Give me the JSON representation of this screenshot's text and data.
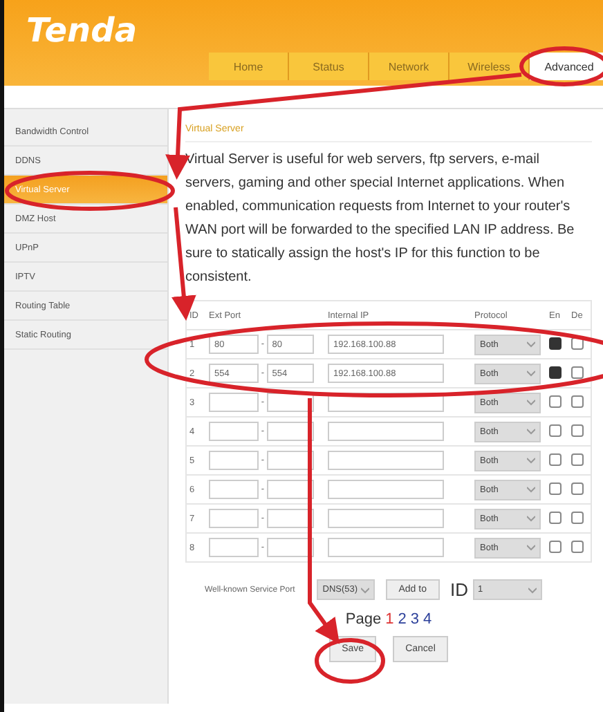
{
  "header": {
    "logo": "Tenda",
    "tabs": [
      {
        "label": "Home",
        "selected": false
      },
      {
        "label": "Status",
        "selected": false
      },
      {
        "label": "Network",
        "selected": false
      },
      {
        "label": "Wireless",
        "selected": false
      },
      {
        "label": "Advanced",
        "selected": true
      }
    ]
  },
  "sidebar": {
    "items": [
      {
        "label": "Bandwidth Control",
        "selected": false
      },
      {
        "label": "DDNS",
        "selected": false
      },
      {
        "label": "Virtual Server",
        "selected": true
      },
      {
        "label": "DMZ Host",
        "selected": false
      },
      {
        "label": "UPnP",
        "selected": false
      },
      {
        "label": "IPTV",
        "selected": false
      },
      {
        "label": "Routing Table",
        "selected": false
      },
      {
        "label": "Static Routing",
        "selected": false
      }
    ]
  },
  "content": {
    "title": "Virtual Server",
    "description": "Virtual Server is useful for web servers, ftp servers, e-mail servers, gaming and other special Internet applications. When enabled, communication requests from Internet to your router's WAN port will be forwarded to the specified LAN IP address. Be sure to statically assign the host's IP for this function to be consistent.",
    "table": {
      "columns": [
        "ID",
        "Ext Port",
        "Internal IP",
        "Protocol",
        "En",
        "De"
      ],
      "rows": [
        {
          "id": "1",
          "start": "80",
          "sep": "-",
          "end": "80",
          "ip": "192.168.100.88",
          "protocol": "Both",
          "enabled": true,
          "delete": false
        },
        {
          "id": "2",
          "start": "554",
          "sep": "-",
          "end": "554",
          "ip": "192.168.100.88",
          "protocol": "Both",
          "enabled": true,
          "delete": false
        },
        {
          "id": "3",
          "sep": "-",
          "protocol": "Both",
          "enabled": false,
          "delete": false
        },
        {
          "id": "4",
          "sep": "-",
          "protocol": "Both",
          "enabled": false,
          "delete": false
        },
        {
          "id": "5",
          "sep": "-",
          "protocol": "Both",
          "enabled": false,
          "delete": false
        },
        {
          "id": "6",
          "sep": "-",
          "protocol": "Both",
          "enabled": false,
          "delete": false
        },
        {
          "id": "7",
          "sep": "-",
          "protocol": "Both",
          "enabled": false,
          "delete": false
        },
        {
          "id": "8",
          "sep": "-",
          "protocol": "Both",
          "enabled": false,
          "delete": false
        }
      ]
    },
    "service_port": {
      "label": "Well-known Service Port",
      "value": "DNS(53)",
      "add_button": "Add to",
      "id_label": "ID",
      "id_value": "1"
    },
    "pagination": {
      "label": "Page",
      "pages": [
        {
          "label": "1",
          "selected": true
        },
        {
          "label": "2",
          "selected": false
        },
        {
          "label": "3",
          "selected": false
        },
        {
          "label": "4",
          "selected": false
        }
      ]
    },
    "buttons": [
      "Save",
      "Cancel"
    ]
  }
}
